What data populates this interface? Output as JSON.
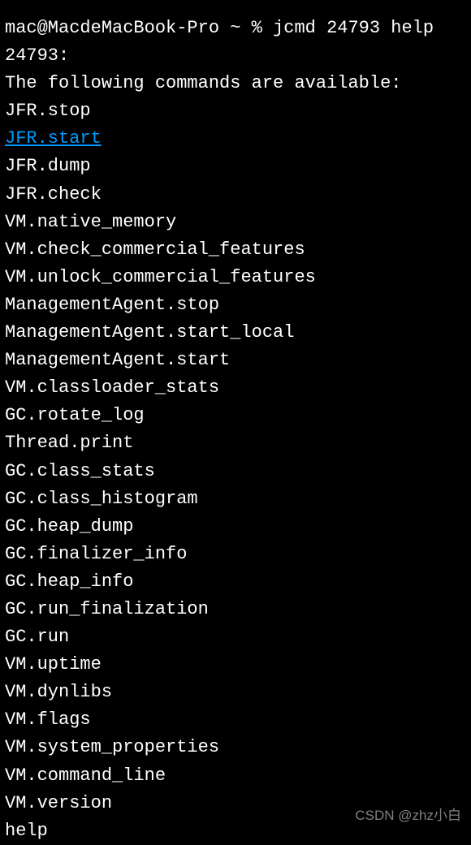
{
  "terminal": {
    "prompt_line": "mac@MacdeMacBook-Pro ~ % jcmd 24793 help",
    "pid_line": "24793:",
    "header_line": "The following commands are available:",
    "commands": [
      "JFR.stop",
      "JFR.start",
      "JFR.dump",
      "JFR.check",
      "VM.native_memory",
      "VM.check_commercial_features",
      "VM.unlock_commercial_features",
      "ManagementAgent.stop",
      "ManagementAgent.start_local",
      "ManagementAgent.start",
      "VM.classloader_stats",
      "GC.rotate_log",
      "Thread.print",
      "GC.class_stats",
      "GC.class_histogram",
      "GC.heap_dump",
      "GC.finalizer_info",
      "GC.heap_info",
      "GC.run_finalization",
      "GC.run",
      "VM.uptime",
      "VM.dynlibs",
      "VM.flags",
      "VM.system_properties",
      "VM.command_line",
      "VM.version",
      "help"
    ],
    "link_index": 1
  },
  "watermark": "CSDN @zhz小白"
}
